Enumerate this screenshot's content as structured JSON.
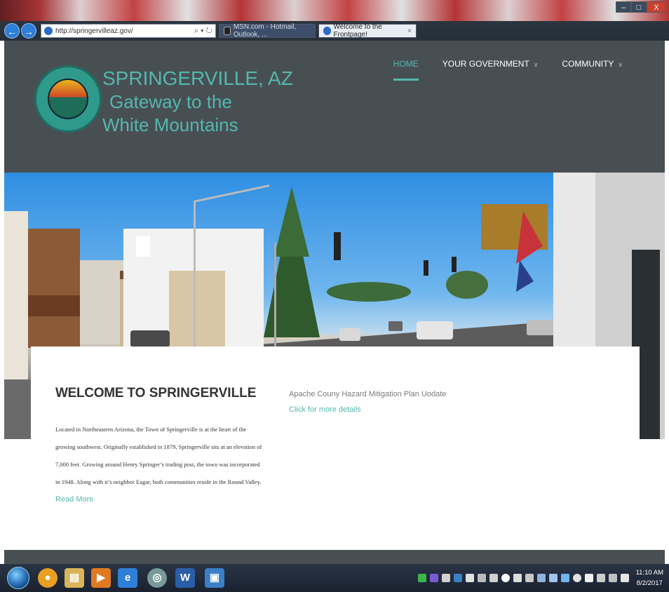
{
  "browser": {
    "address_url": "http://springervilleaz.gov/",
    "address_tools": "⌕ ▾ ↻",
    "tabs": [
      {
        "label": "MSN.com - Hotmail, Outlook, ..."
      },
      {
        "label": "Welcome to the Frontpage!"
      }
    ],
    "tab_close": "×",
    "right_icons": "⌂★⚙",
    "window_controls": {
      "minimize": "–",
      "maximize": "□",
      "close": "X"
    },
    "back_glyph": "←",
    "forward_glyph": "→"
  },
  "site": {
    "title_line1": "SPRINGERVILLE, AZ",
    "title_line2": "Gateway to the",
    "title_line3": "White Mountains",
    "nav": [
      {
        "label": "HOME",
        "active": true
      },
      {
        "label": "YOUR GOVERNMENT",
        "caret": "∨"
      },
      {
        "label": "COMMUNITY",
        "caret": "∨"
      }
    ],
    "colors": {
      "header_bg": "#484f53",
      "accent": "#54b8ad"
    }
  },
  "welcome": {
    "heading_bold": "WELCOME",
    "heading_rest": " TO SPRINGERVILLE",
    "body": "Located in Northeastern Arizona, the Town of Springerville is at the heart of the growing southwest. Originally established in 1879, Springerville sits at an elevation of 7,000 feet. Growing around Henry Springer’s trading post, the town was incorporated in 1948. Along with it’s neighbor Eagar, both communities reside in the Round Valley.",
    "read_more": "Read More"
  },
  "notice": {
    "title": "Apache Couny Hazard Mitigation Plan Uodate",
    "link": "Click for more details"
  },
  "taskbar": {
    "icons": [
      {
        "name": "chrome-icon",
        "glyph": "●",
        "color": "#e8a020"
      },
      {
        "name": "file-explorer-icon",
        "glyph": "▤",
        "color": "#d9b45a"
      },
      {
        "name": "media-player-icon",
        "glyph": "▶",
        "color": "#e07a22"
      },
      {
        "name": "internet-explorer-icon",
        "glyph": "e",
        "color": "#2f7fd8"
      },
      {
        "name": "maps-icon",
        "glyph": "◎",
        "color": "#7a9a9a"
      },
      {
        "name": "word-icon",
        "glyph": "W",
        "color": "#2b5ea8"
      },
      {
        "name": "app-icon",
        "glyph": "▣",
        "color": "#3a7fc8"
      }
    ],
    "time": "11:10 AM",
    "date": "8/2/2017"
  }
}
